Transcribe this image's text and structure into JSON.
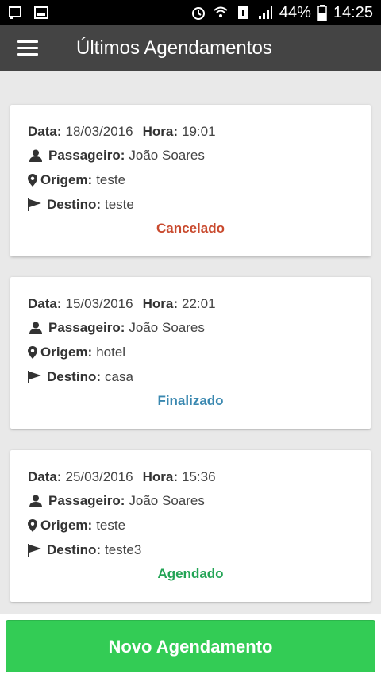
{
  "status_bar": {
    "battery": "44%",
    "time": "14:25"
  },
  "header": {
    "title": "Últimos Agendamentos"
  },
  "labels": {
    "data": "Data:",
    "hora": "Hora:",
    "passageiro": "Passageiro:",
    "origem": "Origem:",
    "destino": "Destino:"
  },
  "bookings": [
    {
      "data": "18/03/2016",
      "hora": "19:01",
      "passageiro": "João Soares",
      "origem": "teste",
      "destino": "teste",
      "status": "Cancelado",
      "status_color": "#c94a2e"
    },
    {
      "data": "15/03/2016",
      "hora": "22:01",
      "passageiro": "João Soares",
      "origem": "hotel",
      "destino": "casa",
      "status": "Finalizado",
      "status_color": "#3a88b0"
    },
    {
      "data": "25/03/2016",
      "hora": "15:36",
      "passageiro": "João Soares",
      "origem": "teste",
      "destino": "teste3",
      "status": "Agendado",
      "status_color": "#23a455"
    }
  ],
  "actions": {
    "new_booking": "Novo Agendamento"
  },
  "colors": {
    "appbar": "#444444",
    "button": "#33cc55"
  }
}
